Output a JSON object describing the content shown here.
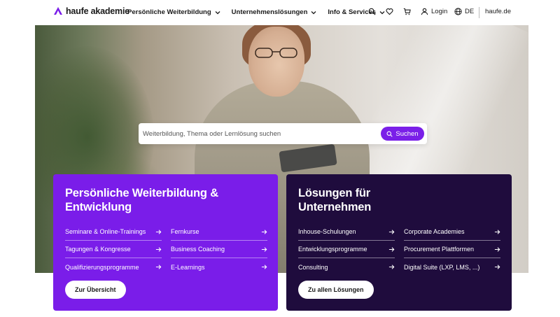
{
  "header": {
    "logo_text": "haufe akademie",
    "nav": [
      {
        "label": "Persönliche Weiterbildung"
      },
      {
        "label": "Unternehmenslösungen"
      },
      {
        "label": "Info & Services"
      }
    ],
    "login_label": "Login",
    "language_label": "DE",
    "external_link": "haufe.de",
    "icons": [
      "search-icon",
      "heart-icon",
      "cart-icon",
      "user-icon",
      "globe-icon"
    ]
  },
  "hero": {
    "search_placeholder": "Weiterbildung, Thema oder Lernlösung suchen",
    "search_button": "Suchen"
  },
  "cards": {
    "personal": {
      "title_line1": "Persönliche Weiterbildung &",
      "title_line2": "Entwicklung",
      "links": [
        "Seminare & Online-Trainings",
        "Fernkurse",
        "Tagungen & Kongresse",
        "Business Coaching",
        "Qualifizierungsprogramme",
        "E-Learnings"
      ],
      "button": "Zur Übersicht"
    },
    "business": {
      "title_line1": "Lösungen für",
      "title_line2": "Unternehmen",
      "links": [
        "Inhouse-Schulungen",
        "Corporate Academies",
        "Entwicklungsprogramme",
        "Procurement Plattformen",
        "Consulting",
        "Digital Suite (LXP, LMS, ...)"
      ],
      "button": "Zu allen Lösungen"
    }
  },
  "colors": {
    "brand_purple": "#7a1de9",
    "dark_purple": "#1f0c3d",
    "text": "#1a1a1a"
  }
}
